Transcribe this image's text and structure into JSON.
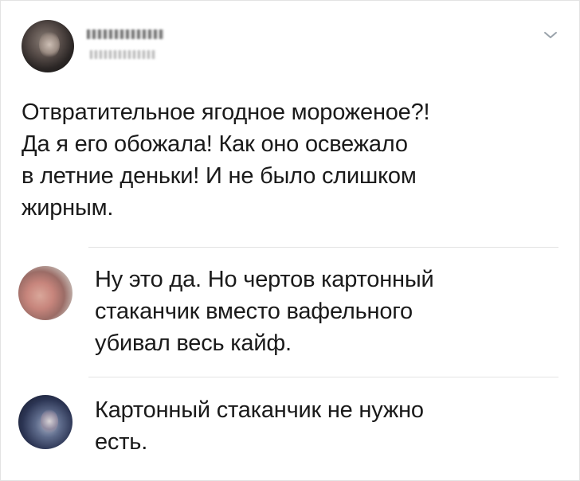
{
  "post": {
    "text": "Отвратительное ягодное мороженое?!\nДа я его обожала! Как оно освежало\nв летние деньки! И не было слишком\nжирным."
  },
  "replies": [
    {
      "text": "Ну это да. Но чертов картонный\nстаканчик вместо вафельного\nубивал весь кайф."
    },
    {
      "text": "Картонный стаканчик не нужно\nесть."
    }
  ],
  "icons": {
    "menu": "chevron-down-icon"
  }
}
